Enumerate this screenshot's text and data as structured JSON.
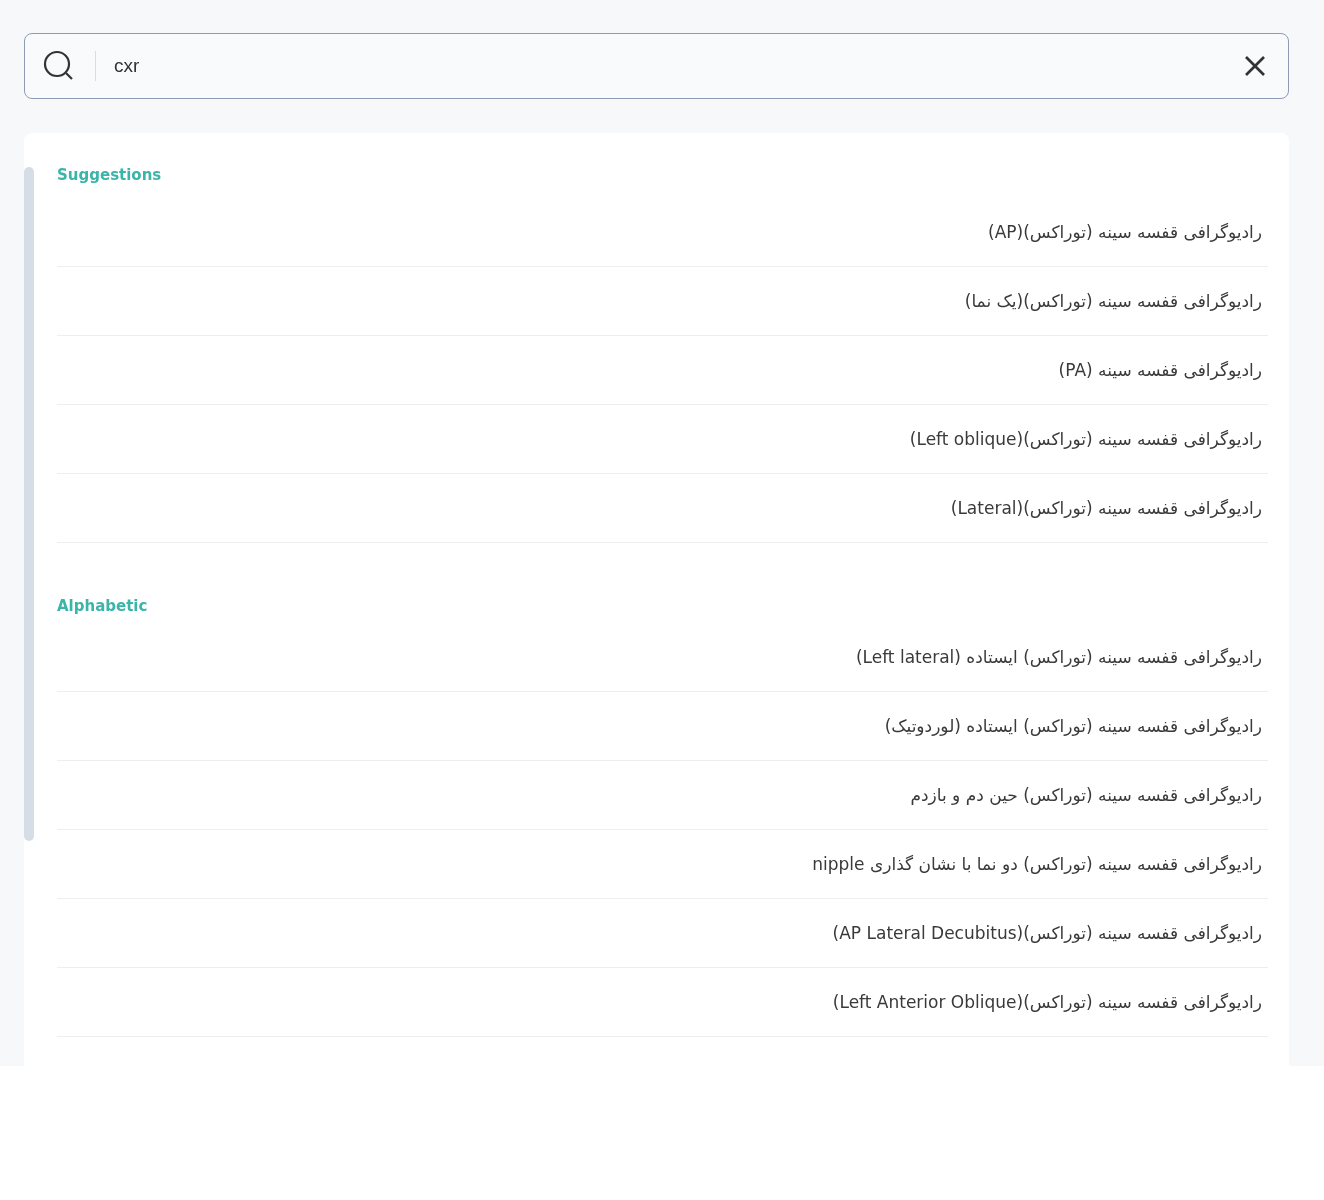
{
  "search": {
    "value": "cxr"
  },
  "sections": [
    {
      "title": "Suggestions",
      "items": [
        "رادیوگرافی قفسه سینه (توراکس)(AP)",
        "رادیوگرافی قفسه سینه (توراکس)(یک نما)",
        "رادیوگرافی قفسه سینه (PA)",
        "رادیوگرافی قفسه سینه (توراکس)(Left oblique)",
        "رادیوگرافی قفسه سینه (توراکس)(Lateral)"
      ]
    },
    {
      "title": "Alphabetic",
      "items": [
        "رادیوگرافی قفسه سینه (توراکس) ایستاده (Left lateral)",
        "رادیوگرافی قفسه سینه (توراکس) ایستاده (لوردوتیک)",
        "رادیوگرافی قفسه سینه (توراکس) حین دم و بازدم",
        "رادیوگرافی قفسه سینه (توراکس) دو نما با نشان گذاری nipple",
        "رادیوگرافی قفسه سینه (توراکس)(AP Lateral Decubitus)",
        "رادیوگرافی قفسه سینه (توراکس)(Left Anterior Oblique)"
      ]
    }
  ]
}
